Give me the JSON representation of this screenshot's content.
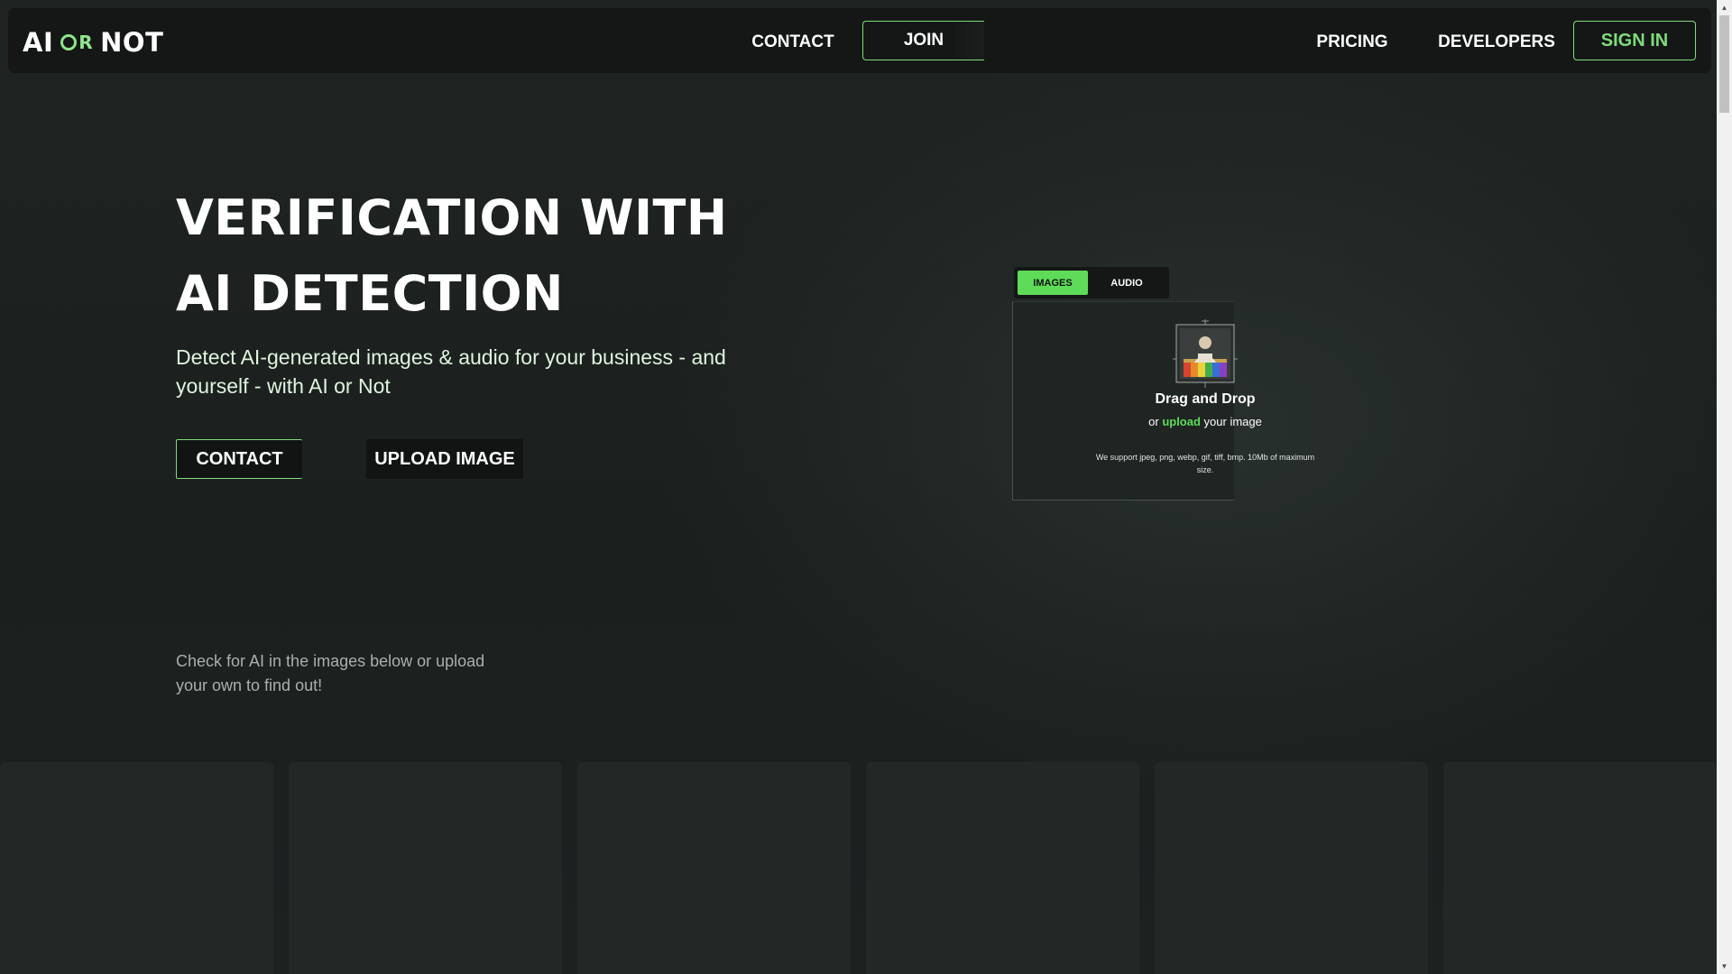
{
  "logo": {
    "part1": "AI",
    "part2": "R",
    "part3": "NOT"
  },
  "nav": {
    "contact": "CONTACT",
    "join": "JOIN",
    "pricing": "PRICING",
    "developers": "DEVELOPERS",
    "sign_in": "SIGN IN"
  },
  "hero": {
    "title_line1": "VERIFICATION WITH",
    "title_line2": "AI DETECTION",
    "subtitle": "Detect AI-generated images & audio for your business - and yourself - with AI or Not",
    "contact_button": "CONTACT",
    "upload_button": "UPLOAD IMAGE"
  },
  "uploader": {
    "tabs": [
      {
        "label": "IMAGES",
        "active": true
      },
      {
        "label": "AUDIO",
        "active": false
      }
    ],
    "title": "Drag and Drop",
    "line_prefix": "or",
    "line_link": "upload",
    "line_suffix": "your image",
    "support_text": "We support jpeg, png, webp, gif, tiff, bmp. 10Mb of maximum size."
  },
  "hint": "Check for AI in the images below or upload your own to find out!",
  "colors": {
    "accent": "#5edb58",
    "accent_border": "#7fdc79",
    "background": "#1d2120",
    "navbar": "#141716"
  }
}
